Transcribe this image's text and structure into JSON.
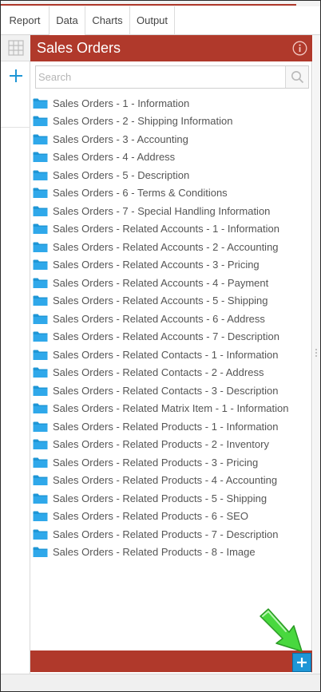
{
  "tabs": [
    {
      "label": "Report"
    },
    {
      "label": "Data"
    },
    {
      "label": "Charts"
    },
    {
      "label": "Output"
    }
  ],
  "active_tab": "Data",
  "panel": {
    "title": "Sales Orders",
    "search": {
      "placeholder": "Search",
      "value": ""
    }
  },
  "items": [
    {
      "label": "Sales Orders - 1 - Information"
    },
    {
      "label": "Sales Orders - 2 - Shipping Information"
    },
    {
      "label": "Sales Orders - 3 - Accounting"
    },
    {
      "label": "Sales Orders - 4 - Address"
    },
    {
      "label": "Sales Orders - 5 - Description"
    },
    {
      "label": "Sales Orders - 6 - Terms & Conditions"
    },
    {
      "label": "Sales Orders - 7 - Special Handling Information"
    },
    {
      "label": "Sales Orders - Related Accounts - 1 - Information"
    },
    {
      "label": "Sales Orders - Related Accounts - 2 - Accounting"
    },
    {
      "label": "Sales Orders - Related Accounts - 3 - Pricing"
    },
    {
      "label": "Sales Orders - Related Accounts - 4 - Payment"
    },
    {
      "label": "Sales Orders - Related Accounts - 5 - Shipping"
    },
    {
      "label": "Sales Orders - Related Accounts - 6 - Address"
    },
    {
      "label": "Sales Orders - Related Accounts - 7 - Description"
    },
    {
      "label": "Sales Orders - Related Contacts - 1 - Information"
    },
    {
      "label": "Sales Orders - Related Contacts - 2 - Address"
    },
    {
      "label": "Sales Orders - Related Contacts - 3 - Description"
    },
    {
      "label": "Sales Orders - Related Matrix Item - 1 - Information"
    },
    {
      "label": "Sales Orders - Related Products - 1 - Information"
    },
    {
      "label": "Sales Orders - Related Products - 2 - Inventory"
    },
    {
      "label": "Sales Orders - Related Products - 3 - Pricing"
    },
    {
      "label": "Sales Orders - Related Products - 4 - Accounting"
    },
    {
      "label": "Sales Orders - Related Products - 5 - Shipping"
    },
    {
      "label": "Sales Orders - Related Products - 6 - SEO"
    },
    {
      "label": "Sales Orders - Related Products - 7 - Description"
    },
    {
      "label": "Sales Orders - Related Products - 8 - Image"
    }
  ],
  "icons": {
    "folder": "folder-icon",
    "search": "search-icon",
    "info": "info-icon",
    "grid": "grid-icon",
    "add": "plus-icon",
    "pointer": "arrow-pointer-icon"
  },
  "colors": {
    "accent_red": "#b0392b",
    "folder_blue": "#1e96d6",
    "add_blue": "#1e96d6",
    "pointer_green": "#3fd23a"
  }
}
